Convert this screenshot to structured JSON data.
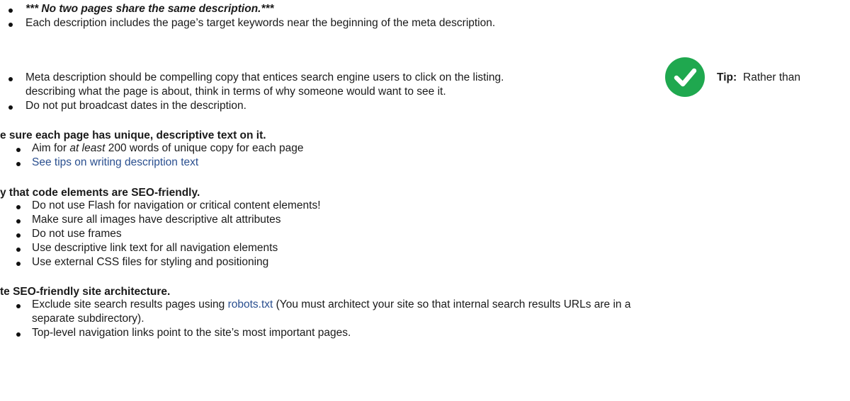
{
  "section1": {
    "items": [
      {
        "text": "*** No two pages share the same description.***"
      },
      {
        "text": "Each description includes the page’s target keywords near the beginning of the meta description."
      },
      {
        "text_before_icon": "Meta description should be compelling copy that entices search engine users to click on the listing.",
        "tip_label": "Tip:",
        "tip_text_line1": "Rather than",
        "text_line2": "describing what the page is about, think in terms of why someone would want to see it."
      },
      {
        "text": "Do not put broadcast dates in the description."
      }
    ],
    "icon": {
      "name": "check-circle-icon",
      "color": "#1fa84f"
    }
  },
  "section2": {
    "heading": "e sure each page has unique, descriptive text on it.",
    "items": [
      {
        "prefix": "Aim for ",
        "emphasis": "at least",
        "suffix": " 200 words of unique copy for each page"
      },
      {
        "link": "See tips on writing description text"
      }
    ]
  },
  "section3": {
    "heading": "y that code elements are SEO-friendly.",
    "items": [
      "Do not use Flash for navigation or critical content elements!",
      "Make sure all images have descriptive alt attributes",
      "Do not use frames",
      "Use descriptive link text for all navigation elements",
      "Use external CSS files for styling and positioning"
    ]
  },
  "section4": {
    "heading": "te SEO-friendly site architecture.",
    "items": [
      {
        "prefix": "Exclude site search results pages using ",
        "link": "robots.txt",
        "suffix_line1": " (You must architect your site so that internal search results URLs are in a",
        "suffix_line2": "separate subdirectory)."
      },
      {
        "text": "Top-level navigation links point to the site’s most important pages."
      }
    ]
  },
  "colors": {
    "link": "#2a4f8f",
    "text": "#1a1a1a",
    "check": "#1fa84f"
  }
}
